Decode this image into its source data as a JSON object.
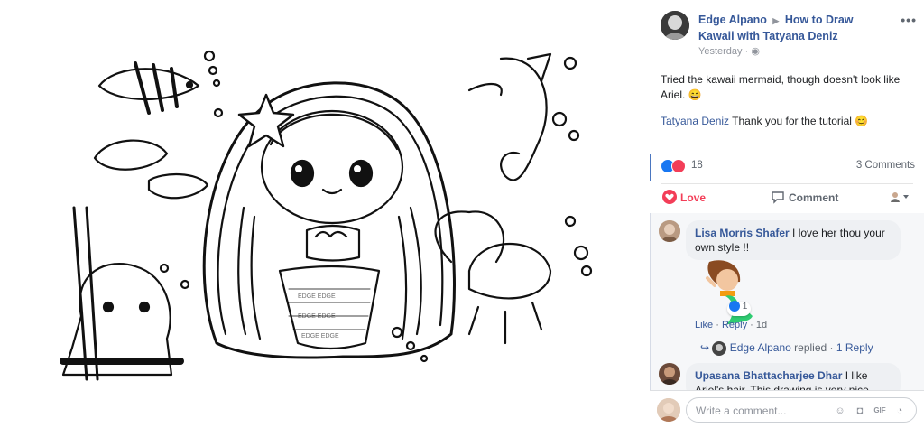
{
  "post": {
    "author": "Edge Alpano",
    "group": "How to Draw Kawaii with Tatyana Deniz",
    "time": "Yesterday",
    "caption": "Tried the kawaii mermaid, though doesn't look like Ariel.",
    "mention": "Tatyana Deniz",
    "mention_text": "Thank you for the tutorial"
  },
  "stats": {
    "reactions": "18",
    "comments": "3 Comments"
  },
  "actions": {
    "love": "Love",
    "comment": "Comment"
  },
  "comments": [
    {
      "name": "Lisa Morris Shafer",
      "text": "I love her thou your own style !!",
      "sticker_reactions": "1",
      "like": "Like",
      "reply": "Reply",
      "time": "1d",
      "replied_by": "Edge Alpano",
      "replied_text": "replied",
      "reply_count": "1 Reply"
    },
    {
      "name": "Upasana Bhattacharjee Dhar",
      "text": "I like Ariel's hair. This drawing is very nice.. will you be"
    }
  ],
  "composer": {
    "placeholder": "Write a comment..."
  },
  "icons": {
    "more": "more-options-icon",
    "like": "like-reaction-icon",
    "love": "love-reaction-icon",
    "comment": "comment-icon",
    "audience": "audience-selector-icon",
    "emoji": "emoji-icon",
    "camera": "camera-icon",
    "gif": "gif-icon",
    "sticker": "sticker-icon"
  },
  "colors": {
    "link": "#365899",
    "love": "#f33e58",
    "like": "#1877f2"
  }
}
